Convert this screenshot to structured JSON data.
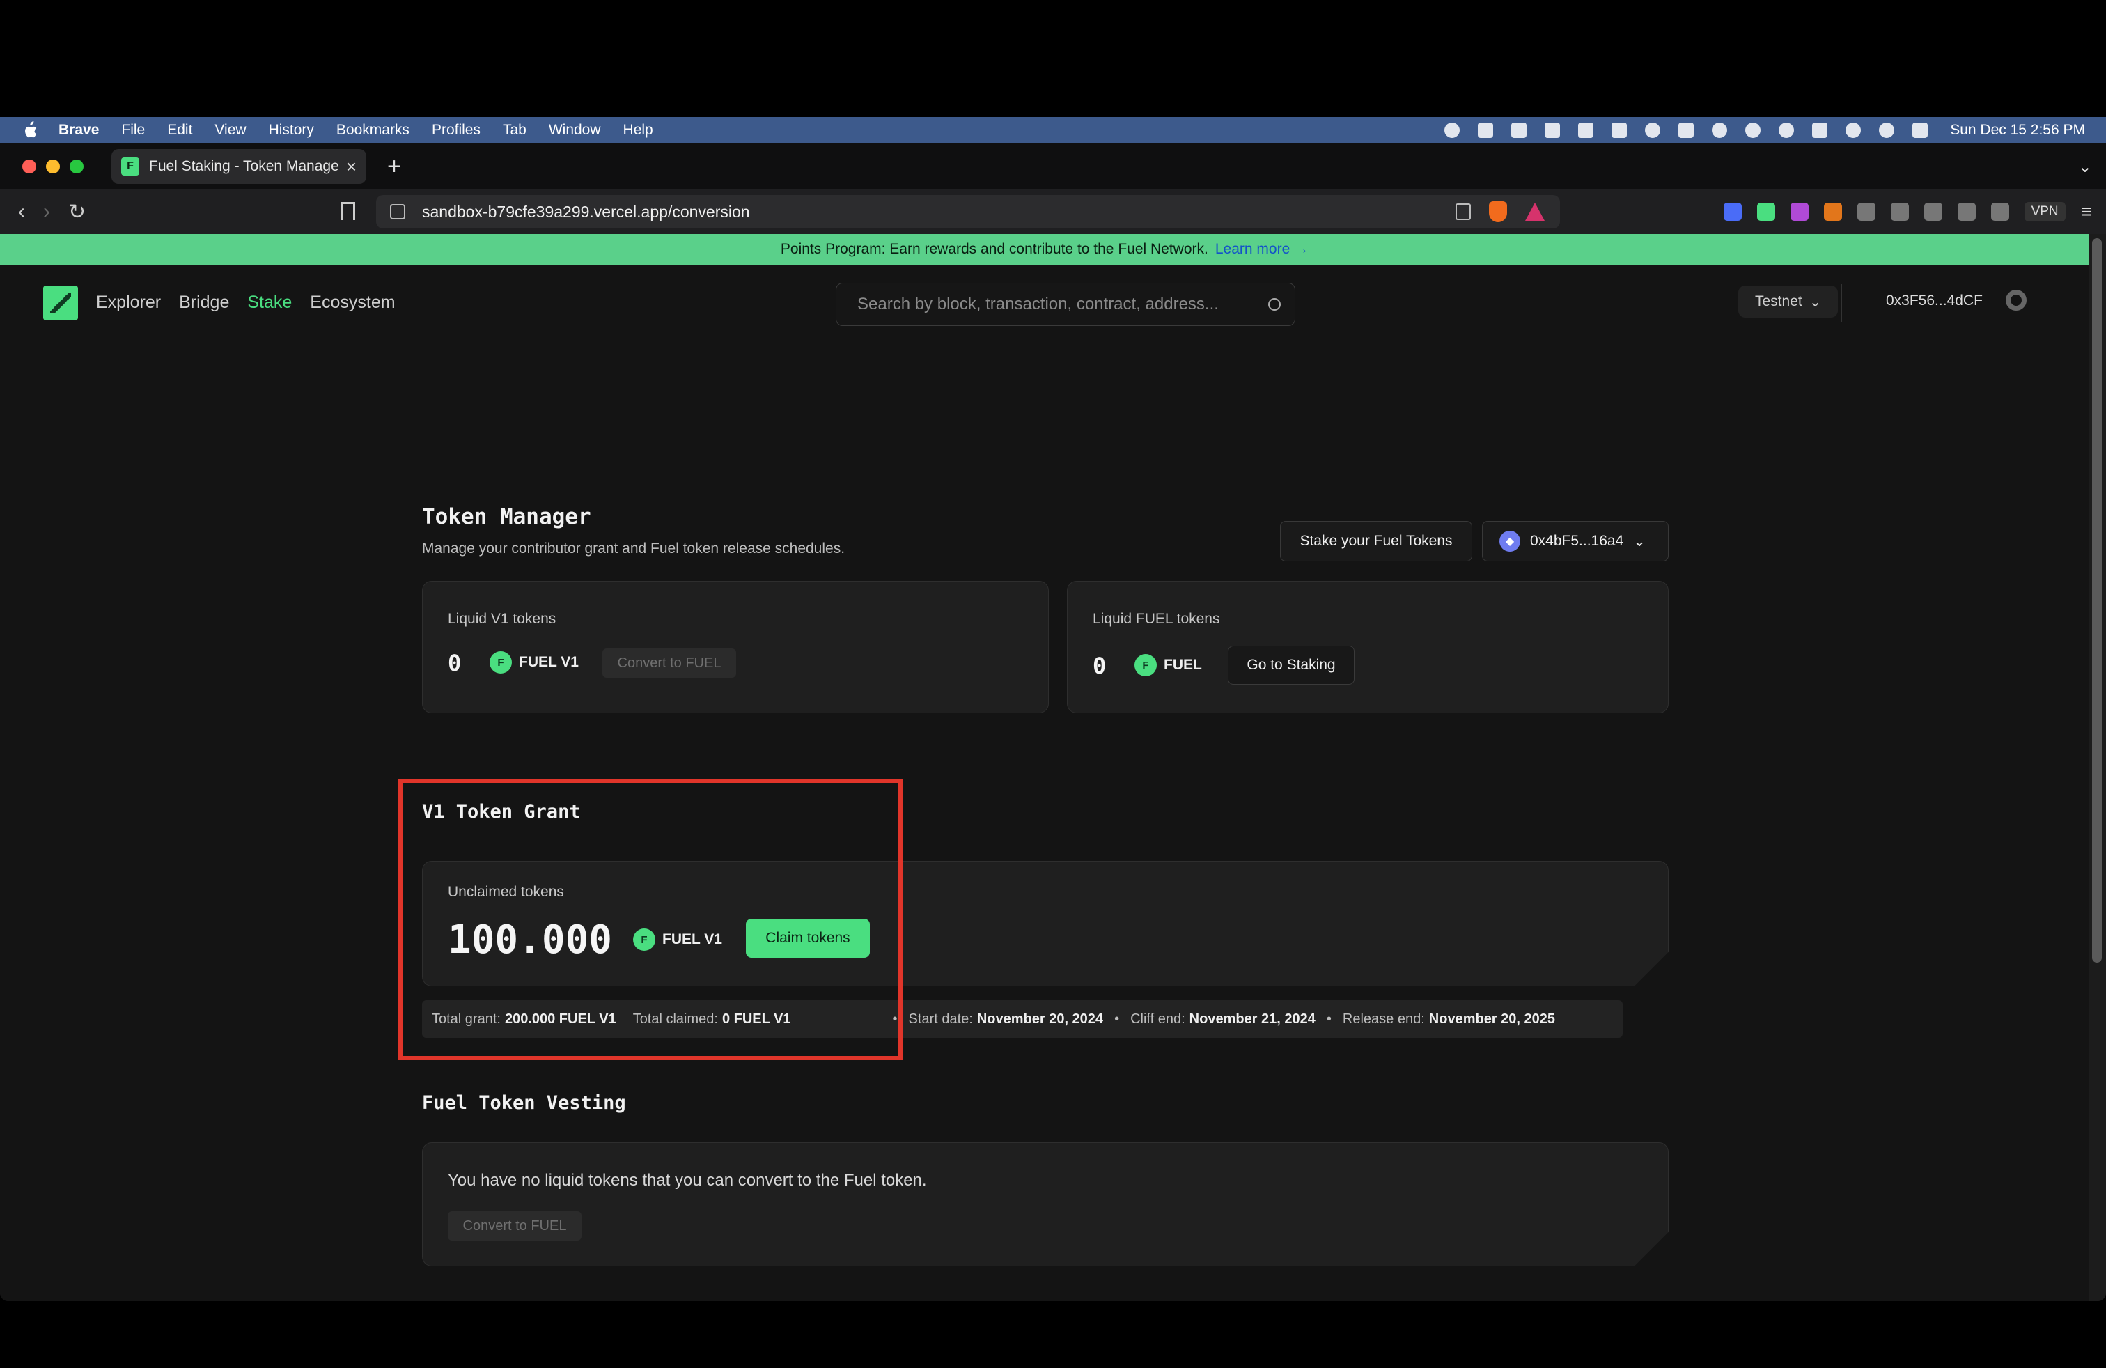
{
  "menubar": {
    "app": "Brave",
    "items": [
      "File",
      "Edit",
      "View",
      "History",
      "Bookmarks",
      "Profiles",
      "Tab",
      "Window",
      "Help"
    ],
    "clock": "Sun Dec 15  2:56 PM"
  },
  "browser": {
    "tab_title": "Fuel Staking - Token Manage",
    "url": "sandbox-b79cfe39a299.vercel.app/conversion",
    "vpn_label": "VPN"
  },
  "banner": {
    "text": "Points Program: Earn rewards and contribute to the Fuel Network.",
    "link": "Learn more →"
  },
  "header": {
    "nav": [
      "Explorer",
      "Bridge",
      "Stake",
      "Ecosystem"
    ],
    "active_nav": "Stake",
    "search_placeholder": "Search by block, transaction, contract, address...",
    "network": "Testnet",
    "account": "0x3F56...4dCF"
  },
  "token_manager": {
    "title": "Token Manager",
    "subtitle": "Manage your contributor grant and Fuel token release schedules.",
    "stake_button": "Stake your Fuel Tokens",
    "wallet_button": "0x4bF5...16a4"
  },
  "liquid_v1": {
    "label": "Liquid V1 tokens",
    "amount": "0",
    "token": "FUEL V1",
    "button": "Convert to FUEL"
  },
  "liquid_fuel": {
    "label": "Liquid FUEL tokens",
    "amount": "0",
    "token": "FUEL",
    "button": "Go to Staking"
  },
  "grant": {
    "title": "V1 Token Grant",
    "unclaimed_label": "Unclaimed tokens",
    "amount": "100.000",
    "token": "FUEL V1",
    "claim_button": "Claim tokens",
    "total_grant_label": "Total grant:",
    "total_grant": "200.000 FUEL V1",
    "total_claimed_label": "Total claimed:",
    "total_claimed": "0 FUEL V1",
    "start_label": "Start date:",
    "start": "November 20, 2024",
    "cliff_label": "Cliff end:",
    "cliff": "November 21, 2024",
    "release_label": "Release end:",
    "release": "November 20, 2025"
  },
  "vesting": {
    "title": "Fuel Token Vesting",
    "message": "You have no liquid tokens that you can convert to the Fuel token.",
    "button": "Convert to FUEL"
  },
  "colors": {
    "accent": "#4ade80",
    "highlight": "#e0352a",
    "menubar": "#3d5a8c"
  }
}
